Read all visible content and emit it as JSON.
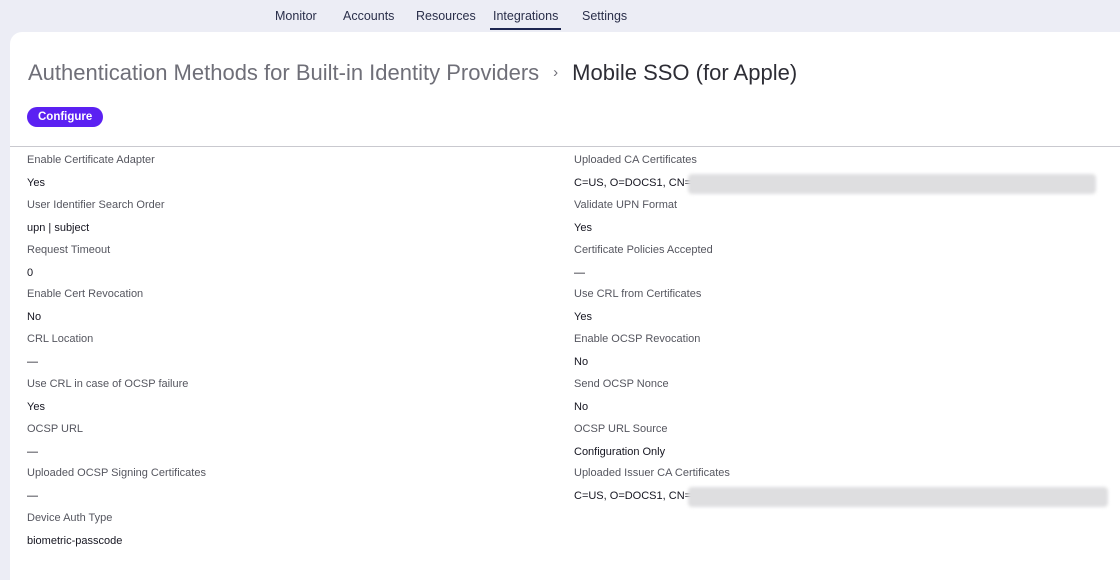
{
  "nav": {
    "tabs": [
      {
        "label": "Monitor"
      },
      {
        "label": "Accounts"
      },
      {
        "label": "Resources"
      },
      {
        "label": "Integrations",
        "active": true
      },
      {
        "label": "Settings"
      }
    ]
  },
  "breadcrumb": {
    "parent": "Authentication Methods for Built-in Identity Providers",
    "separator": "›",
    "current": "Mobile SSO (for Apple)"
  },
  "configure_label": "Configure",
  "accent_color": "#5b21f2",
  "left_fields": [
    {
      "label": "Enable Certificate Adapter",
      "value": "Yes"
    },
    {
      "label": "User Identifier Search Order",
      "value": "upn | subject"
    },
    {
      "label": "Request Timeout",
      "value": "0"
    },
    {
      "label": "Enable Cert Revocation",
      "value": "No"
    },
    {
      "label": "CRL Location",
      "value": "—"
    },
    {
      "label": "Use CRL in case of OCSP failure",
      "value": "Yes"
    },
    {
      "label": "OCSP URL",
      "value": "—"
    },
    {
      "label": "Uploaded OCSP Signing Certificates",
      "value": "—"
    },
    {
      "label": "Device Auth Type",
      "value": "biometric-passcode"
    }
  ],
  "right_fields": [
    {
      "label": "Uploaded CA Certificates",
      "value": "C=US, O=DOCS1, CN="
    },
    {
      "label": "Validate UPN Format",
      "value": "Yes"
    },
    {
      "label": "Certificate Policies Accepted",
      "value": "—"
    },
    {
      "label": "Use CRL from Certificates",
      "value": "Yes"
    },
    {
      "label": "Enable OCSP Revocation",
      "value": "No"
    },
    {
      "label": "Send OCSP Nonce",
      "value": "No"
    },
    {
      "label": "OCSP URL Source",
      "value": "Configuration Only"
    },
    {
      "label": "Uploaded Issuer CA Certificates",
      "value": "C=US, O=DOCS1, CN="
    }
  ]
}
